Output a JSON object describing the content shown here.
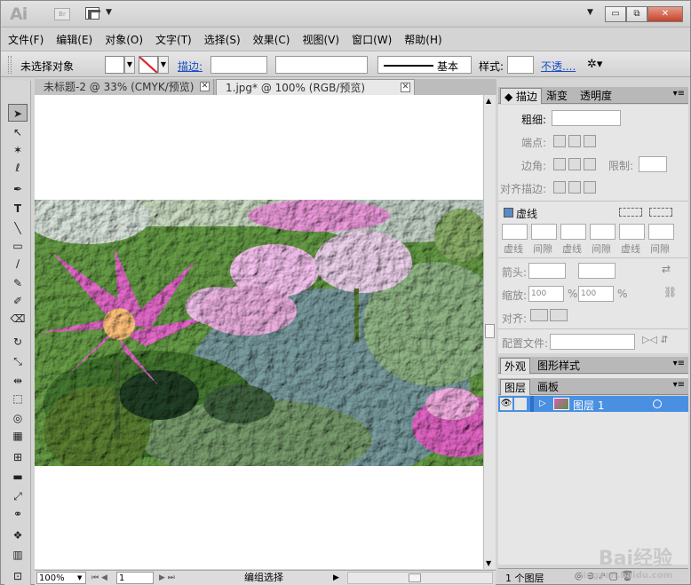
{
  "app": {
    "logo": "Ai",
    "bridge": "Br"
  },
  "window_controls": {
    "minimize": "▭",
    "restore": "⧉",
    "close": "✕"
  },
  "menu": [
    "文件(F)",
    "编辑(E)",
    "对象(O)",
    "文字(T)",
    "选择(S)",
    "效果(C)",
    "视图(V)",
    "窗口(W)",
    "帮助(H)"
  ],
  "control": {
    "no_selection": "未选择对象",
    "stroke_label": "描边:",
    "brush_value": "基本",
    "style_label": "样式:",
    "opacity_link": "不透...."
  },
  "tabs": [
    {
      "label": "未标题-2 @ 33% (CMYK/预览)",
      "active": false
    },
    {
      "label": "1.jpg* @ 100% (RGB/预览)",
      "active": true
    }
  ],
  "status": {
    "zoom": "100%",
    "page": "1",
    "mode": "编组选择"
  },
  "panels": {
    "stroke_group_tabs": [
      "描边",
      "渐变",
      "透明度"
    ],
    "stroke": {
      "weight_label": "粗细:",
      "cap_label": "端点:",
      "corner_label": "边角:",
      "limit_label": "限制:",
      "align_label": "对齐描边:",
      "dashed_label": "虚线",
      "dash_gap_labels": [
        "虚线",
        "间隙",
        "虚线",
        "间隙",
        "虚线",
        "间隙"
      ],
      "arrow_label": "箭头:",
      "scale_label": "缩放:",
      "scale_a": "100",
      "scale_b": "100",
      "pct": "%",
      "align2_label": "对齐:",
      "profile_label": "配置文件:"
    },
    "appearance_tabs": [
      "外观",
      "图形样式"
    ],
    "layers_tabs": [
      "图层",
      "画板"
    ],
    "layer_name": "图层 1",
    "layer_count": "1 个图层"
  },
  "watermark": {
    "brand": "Bai经验",
    "url": "jingyan.baidu.com"
  }
}
